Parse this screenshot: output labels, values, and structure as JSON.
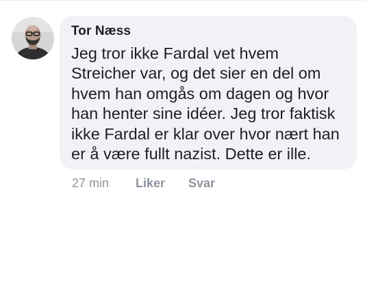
{
  "comment": {
    "author": "Tor Næss",
    "lines": [
      "Jeg tror ikke Fardal vet hvem",
      "Streicher var, og det sier en del om",
      "hvem han omgås om dagen og hvor",
      "han henter sine idéer. Jeg tror faktisk",
      "ikke Fardal er klar over hvor nært han",
      "er å være fullt nazist. Dette er ille."
    ],
    "timestamp": "27 min",
    "like_label": "Liker",
    "reply_label": "Svar"
  },
  "colors": {
    "bubble_background": "#f0f2f5",
    "text": "#1c1e21",
    "meta_text": "#8d949e"
  },
  "icons": {
    "avatar": "profile-photo"
  }
}
